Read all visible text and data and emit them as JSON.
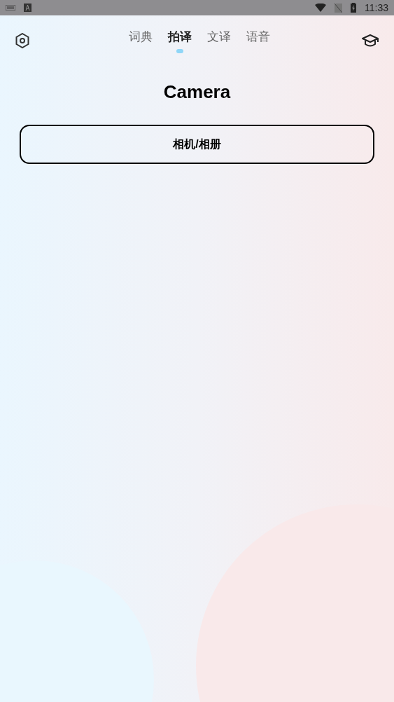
{
  "status_bar": {
    "time": "11:33"
  },
  "tabs": [
    {
      "label": "词典",
      "selected": false
    },
    {
      "label": "拍译",
      "selected": true
    },
    {
      "label": "文译",
      "selected": false
    },
    {
      "label": "语音",
      "selected": false
    }
  ],
  "title": "Camera",
  "button": "相机/相册"
}
